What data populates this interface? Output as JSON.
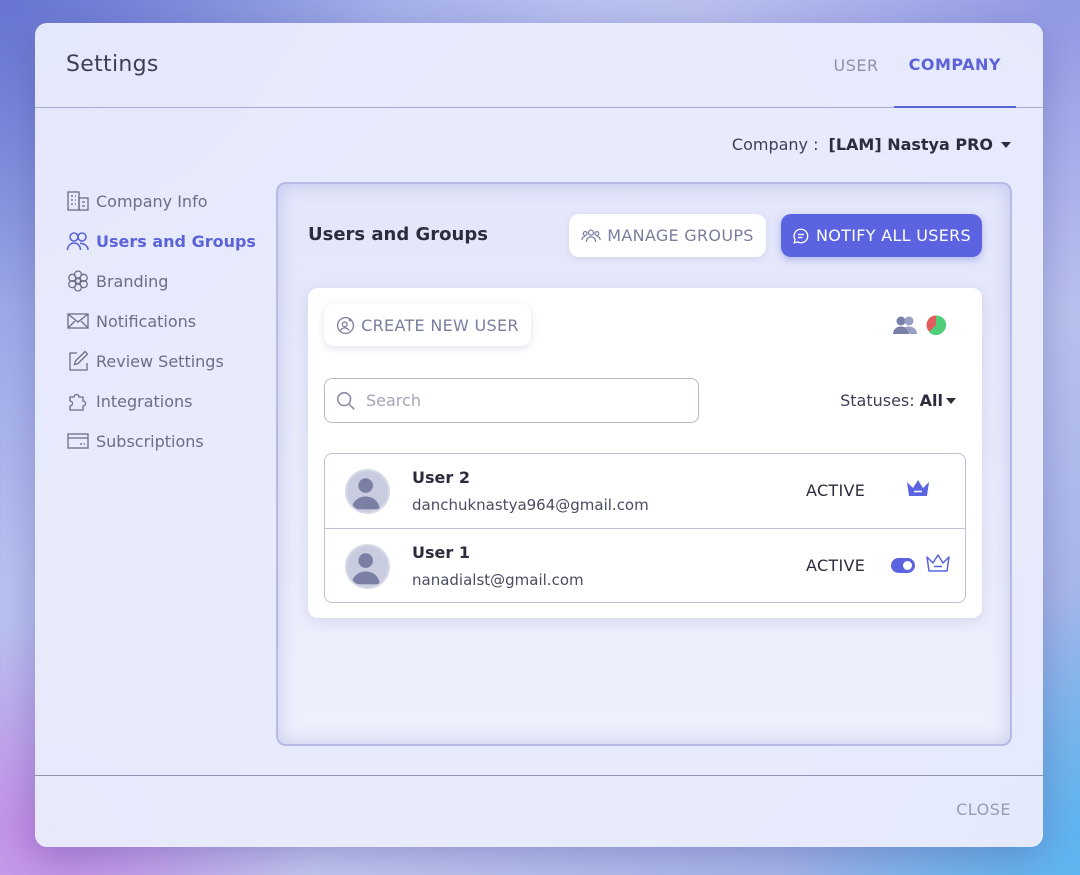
{
  "modal": {
    "title": "Settings",
    "tabs": [
      {
        "label": "USER",
        "active": false
      },
      {
        "label": "COMPANY",
        "active": true
      }
    ]
  },
  "company": {
    "label": "Company :",
    "value": "[LAM] Nastya PRO"
  },
  "sidebar": {
    "items": [
      {
        "label": "Company Info",
        "icon": "building-icon",
        "active": false
      },
      {
        "label": "Users and Groups",
        "icon": "users-icon",
        "active": true
      },
      {
        "label": "Branding",
        "icon": "flower-icon",
        "active": false
      },
      {
        "label": "Notifications",
        "icon": "envelope-icon",
        "active": false
      },
      {
        "label": "Review Settings",
        "icon": "edit-icon",
        "active": false
      },
      {
        "label": "Integrations",
        "icon": "puzzle-icon",
        "active": false
      },
      {
        "label": "Subscriptions",
        "icon": "card-icon",
        "active": false
      }
    ]
  },
  "panel": {
    "title": "Users and Groups",
    "manage_groups_label": "MANAGE GROUPS",
    "notify_all_label": "NOTIFY ALL USERS",
    "create_user_label": "CREATE NEW USER",
    "search_placeholder": "Search",
    "statuses_label": "Statuses:",
    "statuses_value": "All"
  },
  "users": [
    {
      "name": "User 2",
      "email": "danchuknastya964@gmail.com",
      "status": "ACTIVE",
      "owner": true,
      "toggle": false
    },
    {
      "name": "User 1",
      "email": "nanadialst@gmail.com",
      "status": "ACTIVE",
      "owner": false,
      "toggle": true
    }
  ],
  "footer": {
    "close_label": "CLOSE"
  },
  "colors": {
    "accent": "#5c63e0",
    "text": "#2b2d3c",
    "muted": "#7a7e9e"
  }
}
